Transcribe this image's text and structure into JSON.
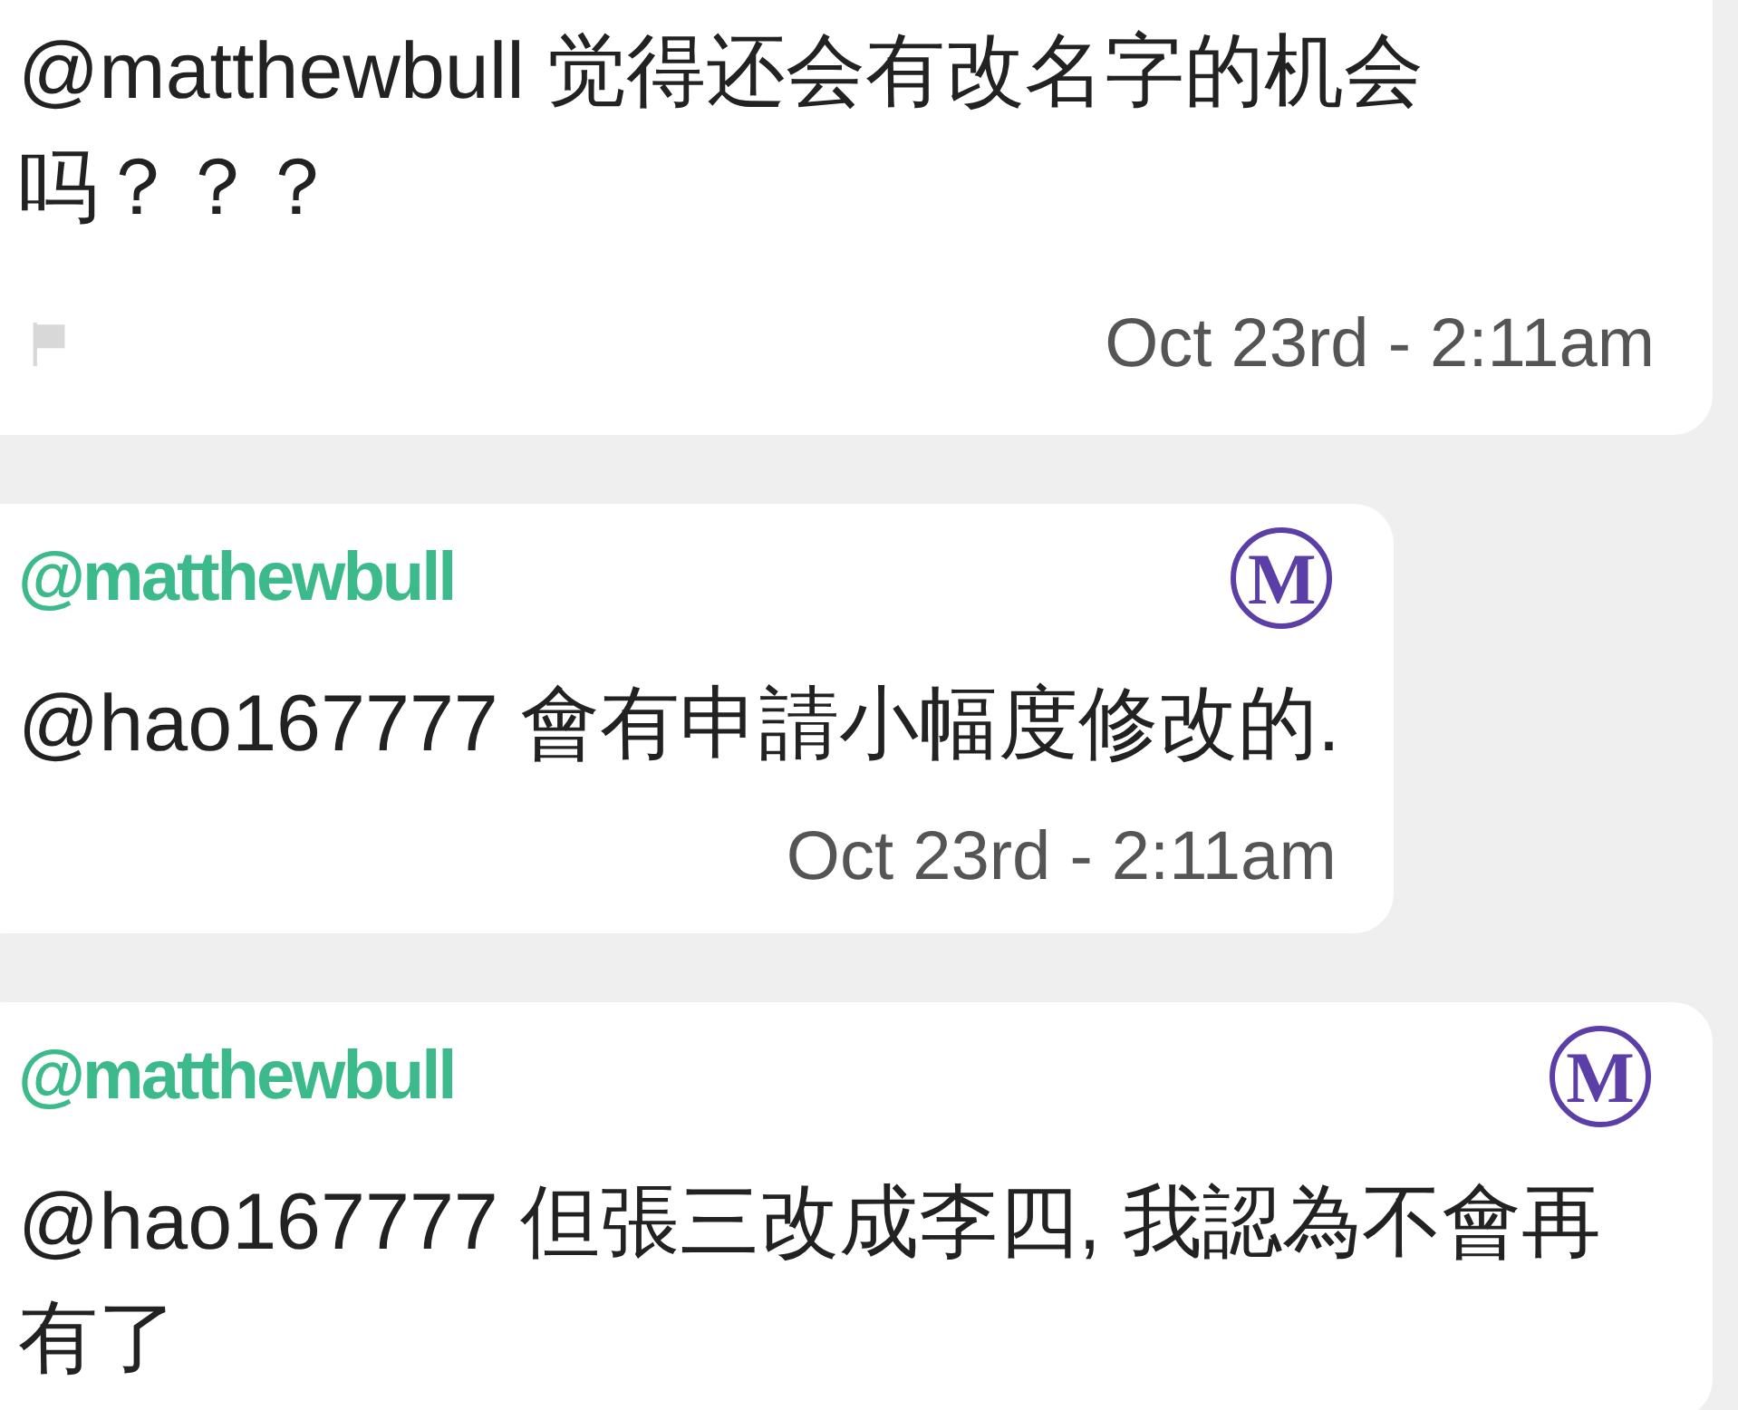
{
  "comments": [
    {
      "text": "@matthewbull 觉得还会有改名字的机会吗？？？",
      "flag": true,
      "time": "Oct 23rd - 2:11am"
    },
    {
      "author": "@matthewbull",
      "badge": "M",
      "text": "@hao167777 會有申請小幅度修改的.",
      "flag": false,
      "time": "Oct 23rd - 2:11am"
    },
    {
      "author": "@matthewbull",
      "badge": "M",
      "text": "@hao167777 但張三改成李四, 我認為不會再有了",
      "flag": false
    }
  ]
}
